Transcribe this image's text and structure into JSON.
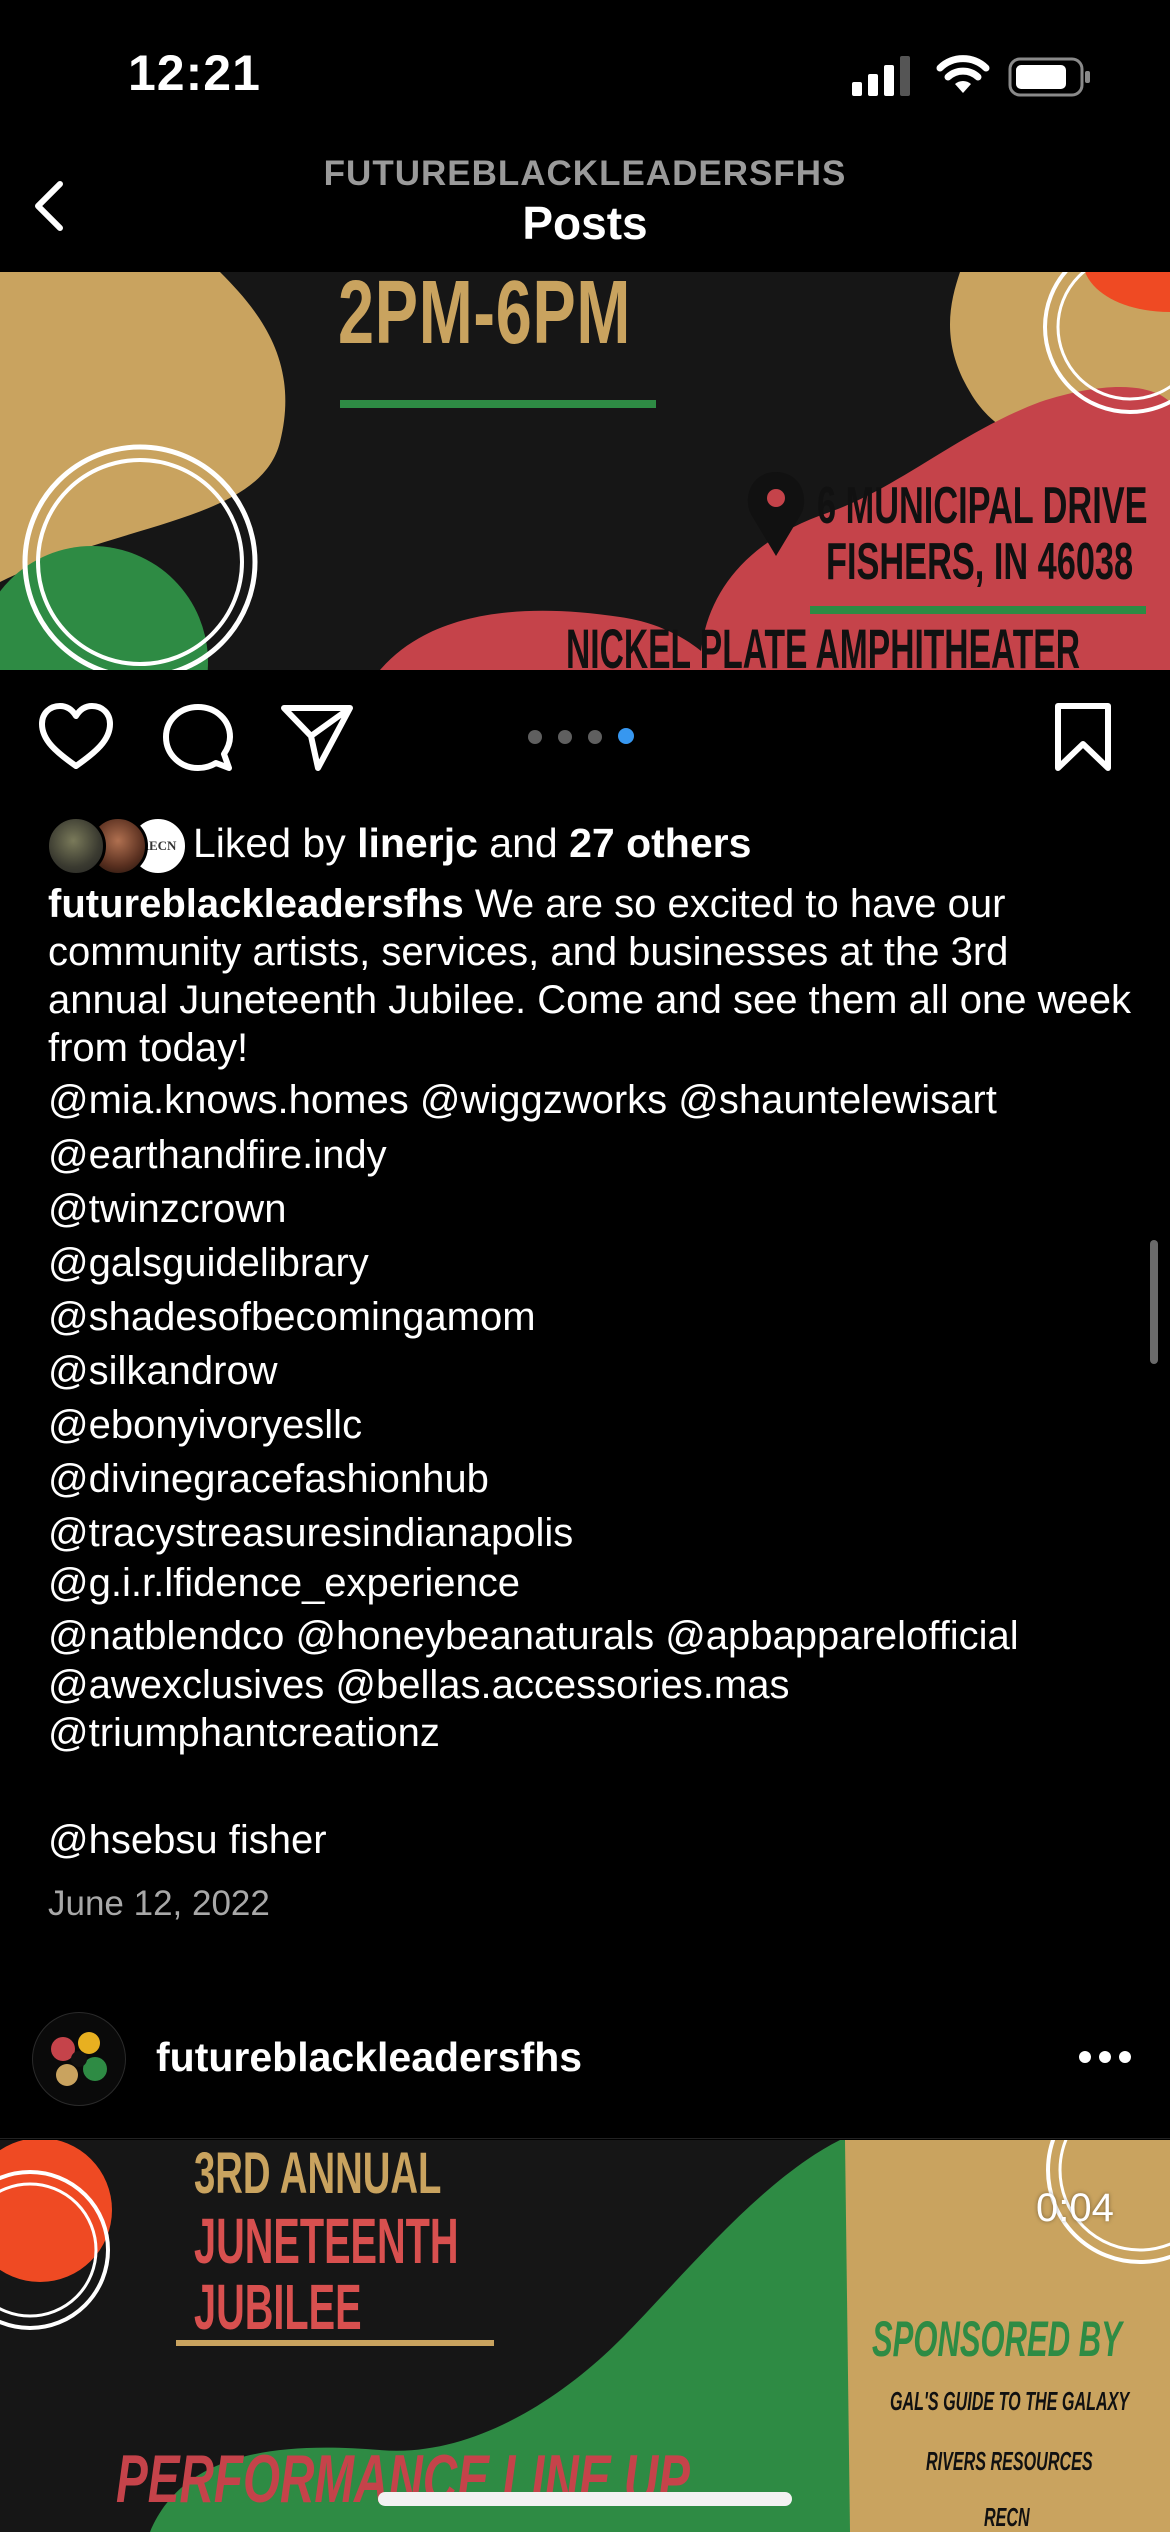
{
  "status_bar": {
    "time": "12:21"
  },
  "nav": {
    "subtitle": "FUTUREBLACKLEADERSFHS",
    "title": "Posts"
  },
  "poster1": {
    "time_text": "2PM-6PM",
    "address_line1": "6 MUNICIPAL DRIVE",
    "address_line2": "FISHERS, IN 46038",
    "venue": "NICKEL PLATE AMPHITHEATER"
  },
  "carousel": {
    "count": 4,
    "active_index": 3
  },
  "likes": {
    "prefix": "Liked by ",
    "user": "linerjc",
    "middle": " and ",
    "others": "27 others",
    "avatar3_text": "RECN"
  },
  "caption": {
    "username": "futureblackleadersfhs",
    "text": " We are so excited to have our community artists, services, and businesses at the 3rd annual Juneteenth Jubilee. Come and see them all one week from today!",
    "mentions": [
      "@mia.knows.homes @wiggzworks @shauntelewisart",
      "@earthandfire.indy",
      "@twinzcrown",
      "@galsguidelibrary",
      "@shadesofbecomingamom",
      "@silkandrow",
      "@ebonyivoryesllc",
      "@divinegracefashionhub",
      "@tracystreasuresindianapolis",
      "@g.i.r.lfidence_experience",
      "@natblendco @honeybeanaturals @apbapparelofficial",
      "@awexclusives @bellas.accessories.mas",
      "@triumphantcreationz",
      "@hsebsu fisher"
    ]
  },
  "date": "June 12, 2022",
  "post2": {
    "username": "futureblackleadersfhs",
    "timer": "0:04",
    "poster_title_1": "3RD ANNUAL",
    "poster_title_2": "JUNETEENTH",
    "poster_title_3": "JUBILEE",
    "poster_lineup": "PERFORMANCE LINE UP",
    "sponsored_by": "SPONSORED BY",
    "sponsor1": "GAL'S GUIDE TO THE GALAXY",
    "sponsor2": "RIVERS RESOURCES",
    "sponsor3": "RECN"
  },
  "colors": {
    "tan": "#c9a35f",
    "red": "#c5434a",
    "green": "#2e8b44",
    "orange": "#ef4a23",
    "accent_blue": "#3797f0"
  }
}
